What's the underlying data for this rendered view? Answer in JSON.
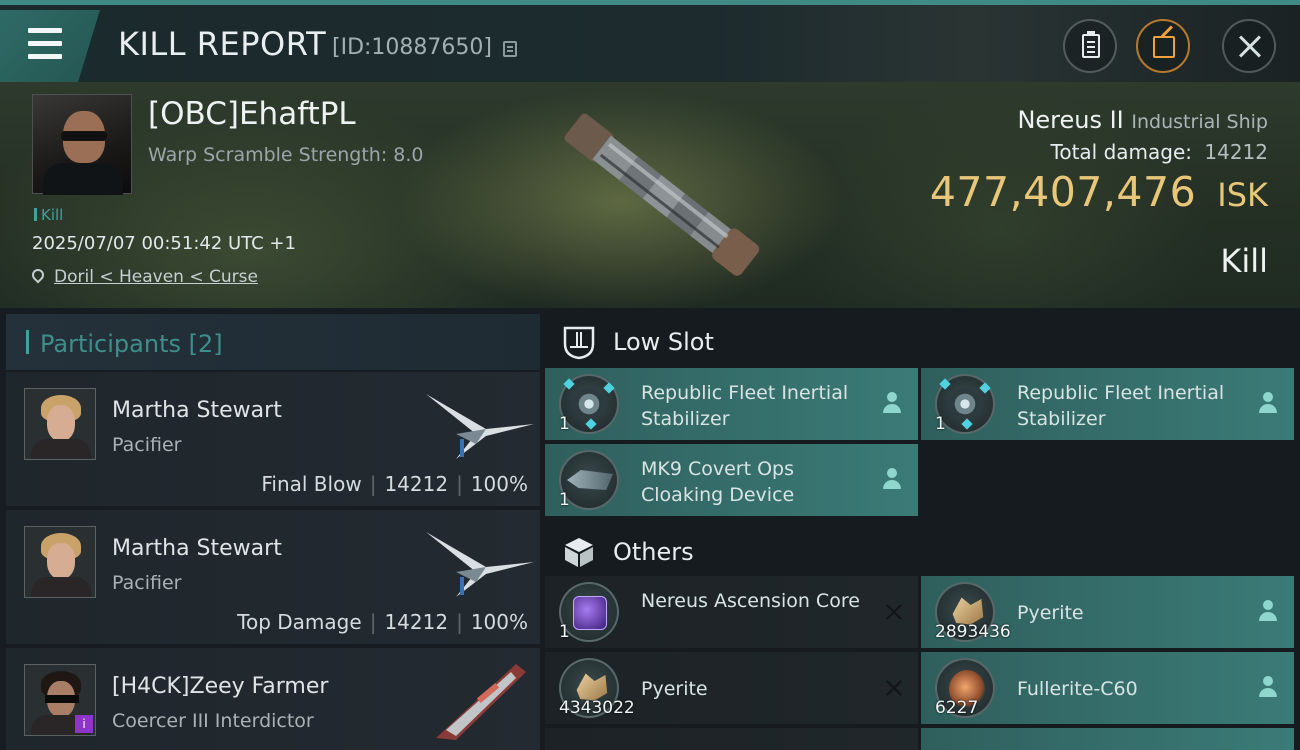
{
  "header": {
    "title": "KILL REPORT",
    "report_id": "[ID:10887650]"
  },
  "victim": {
    "name": "[OBC]EhaftPL",
    "warp_scramble": "Warp Scramble Strength: 8.0",
    "tag": "Kill",
    "timestamp": "2025/07/07 00:51:42 UTC +1",
    "location": "Doril < Heaven < Curse"
  },
  "ship": {
    "name": "Nereus II",
    "class": "Industrial Ship",
    "total_damage_label": "Total damage:",
    "total_damage": "14212",
    "isk_value": "477,407,476",
    "isk_unit": "ISK",
    "result": "Kill"
  },
  "participants": {
    "title": "Participants [2]",
    "items": [
      {
        "name": "Martha Stewart",
        "ship": "Pacifier",
        "role": "Final Blow",
        "damage": "14212",
        "percent": "100%"
      },
      {
        "name": "Martha Stewart",
        "ship": "Pacifier",
        "role": "Top Damage",
        "damage": "14212",
        "percent": "100%"
      },
      {
        "name": "[H4CK]Zeey Farmer",
        "ship": "Coercer III Interdictor",
        "badge": "i"
      }
    ]
  },
  "fitting": {
    "low_slot": {
      "title": "Low Slot",
      "items": [
        {
          "name": "Republic Fleet Inertial Stabilizer",
          "qty": "1",
          "status": "dropped"
        },
        {
          "name": "Republic Fleet Inertial Stabilizer",
          "qty": "1",
          "status": "dropped"
        },
        {
          "name": "MK9 Covert Ops Cloaking Device",
          "qty": "1",
          "status": "dropped"
        }
      ]
    },
    "others": {
      "title": "Others",
      "items": [
        {
          "name": "Nereus Ascension Core",
          "qty": "1",
          "status": "destroyed"
        },
        {
          "name": "Pyerite",
          "qty": "2893436",
          "status": "dropped"
        },
        {
          "name": "Pyerite",
          "qty": "4343022",
          "status": "destroyed"
        },
        {
          "name": "Fullerite-C60",
          "qty": "6227",
          "status": "dropped"
        }
      ]
    }
  },
  "colors": {
    "accent_teal": "#3fa39c",
    "isk_gold": "#e8c77a",
    "dropped_tile": "#3b7b77",
    "destroyed_tile": "#20272b"
  }
}
